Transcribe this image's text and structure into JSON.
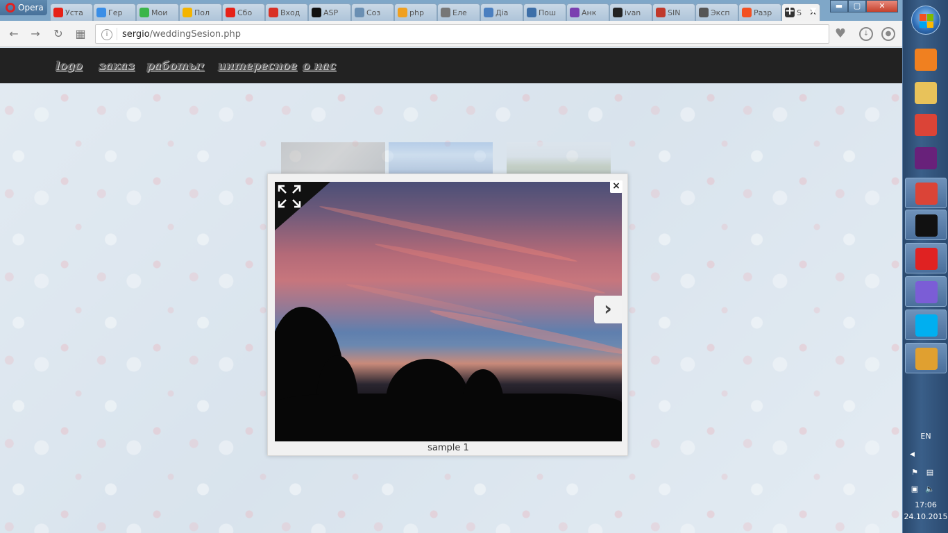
{
  "browser": {
    "name": "Opera",
    "tabs": [
      {
        "title": "Уста",
        "favicon": "youtube-icon",
        "color": "#e62117"
      },
      {
        "title": "Гер",
        "favicon": "bird-icon",
        "color": "#3a8ee6"
      },
      {
        "title": "Мои",
        "favicon": "plus-circle-icon",
        "color": "#3bb54a"
      },
      {
        "title": "Пол",
        "favicon": "yandex-icon",
        "color": "#f4b400"
      },
      {
        "title": "Сбо",
        "favicon": "youtube-icon",
        "color": "#e62117"
      },
      {
        "title": "Вход",
        "favicon": "gmail-icon",
        "color": "#d93025"
      },
      {
        "title": "ASP",
        "favicon": "dou-icon",
        "color": "#111111"
      },
      {
        "title": "Соз",
        "favicon": "habr-icon",
        "color": "#6a8fb3"
      },
      {
        "title": "php",
        "favicon": "phpmyadmin-icon",
        "color": "#f0a020"
      },
      {
        "title": "Еле",
        "favicon": "document-icon",
        "color": "#777777"
      },
      {
        "title": "Діа",
        "favicon": "chat-icon",
        "color": "#4a7fc0"
      },
      {
        "title": "Пош",
        "favicon": "pause-icon",
        "color": "#3d6fa8"
      },
      {
        "title": "Анк",
        "favicon": "form-icon",
        "color": "#7b3fb0"
      },
      {
        "title": "ivan",
        "favicon": "github-icon",
        "color": "#222222"
      },
      {
        "title": "SIN",
        "favicon": "thermometer-icon",
        "color": "#c0392b"
      },
      {
        "title": "Эксп",
        "favicon": "grid-icon",
        "color": "#555555"
      },
      {
        "title": "Разр",
        "favicon": "windows-icon",
        "color": "#f25022"
      },
      {
        "title": "S",
        "favicon": "camera-icon",
        "color": "#333333",
        "active": true
      }
    ],
    "new_tab_label": "+",
    "address": {
      "host": "sergio",
      "path": "/weddingSesion.php"
    }
  },
  "site": {
    "nav": [
      {
        "label": "logo"
      },
      {
        "label": "заказ"
      },
      {
        "label": "работы",
        "dropdown": true
      },
      {
        "label": "интересное"
      },
      {
        "label": "о нас"
      }
    ]
  },
  "lightbox": {
    "caption": "sample 1",
    "close_label": "×",
    "next_label": "›"
  },
  "taskbar": {
    "language": "EN",
    "time": "17:06",
    "date": "24.10.2015",
    "apps": [
      {
        "name": "media-player-icon",
        "color": "#f08020"
      },
      {
        "name": "file-explorer-icon",
        "color": "#e8c25a"
      },
      {
        "name": "chrome-icon",
        "color": "#db4437"
      },
      {
        "name": "visual-studio-icon",
        "color": "#68217a"
      },
      {
        "name": "chrome-icon",
        "color": "#db4437"
      },
      {
        "name": "command-prompt-icon",
        "color": "#111111"
      },
      {
        "name": "opera-icon",
        "color": "#e02222"
      },
      {
        "name": "phpstorm-icon",
        "color": "#7b5dd6"
      },
      {
        "name": "skype-icon",
        "color": "#00aff0"
      },
      {
        "name": "paint-icon",
        "color": "#e0a030"
      }
    ]
  }
}
